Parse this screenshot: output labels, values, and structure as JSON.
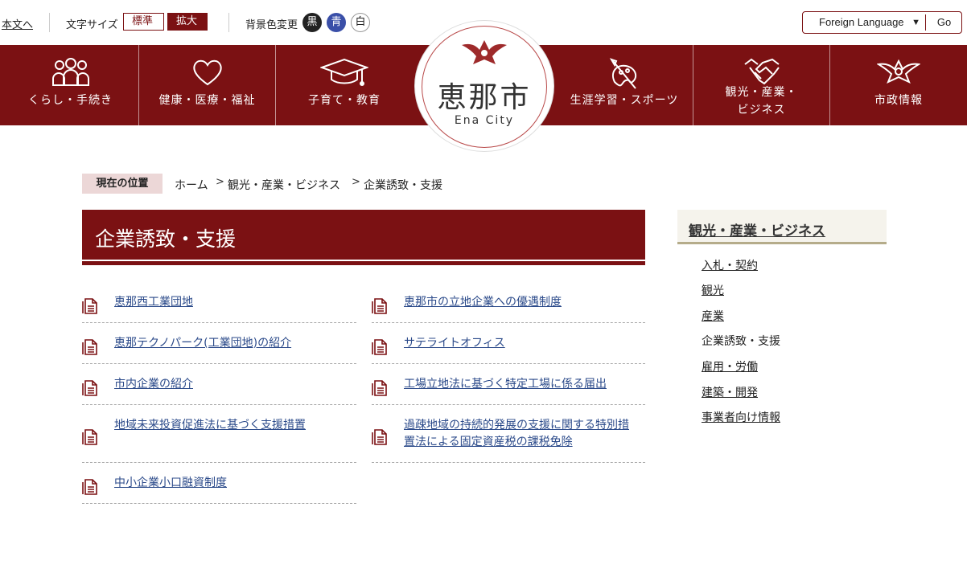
{
  "utility": {
    "skip_link": "本文へ",
    "font_size_label": "文字サイズ",
    "font_standard": "標準",
    "font_large": "拡大",
    "bg_label": "背景色変更",
    "bg_black": "黒",
    "bg_blue": "青",
    "bg_white": "白",
    "language_selected": "Foreign Language",
    "language_go": "Go"
  },
  "nav": {
    "items": [
      {
        "label": "くらし・手続き",
        "icon": "people-icon"
      },
      {
        "label": "健康・医療・福祉",
        "icon": "heart-icon"
      },
      {
        "label": "子育て・教育",
        "icon": "graduation-cap-icon"
      },
      {
        "label": "生涯学習・スポーツ",
        "icon": "palette-icon"
      },
      {
        "label_line1": "観光・産業・",
        "label_line2": "ビジネス",
        "icon": "handshake-icon"
      },
      {
        "label": "市政情報",
        "icon": "city-emblem-icon"
      }
    ],
    "logo_kanji": "恵那市",
    "logo_en": "Ena City"
  },
  "breadcrumb": {
    "here_label": "現在の位置",
    "items": [
      "ホーム",
      "観光・産業・ビジネス",
      "企業誘致・支援"
    ]
  },
  "page_title": "企業誘致・支援",
  "links_left": [
    {
      "line1": "恵那西工業団地"
    },
    {
      "line1": "恵那テクノパーク(工業団地)の紹介"
    },
    {
      "line1": "市内企業の紹介"
    },
    {
      "line1": "地域未来投資促進法に基づく支援措置"
    },
    {
      "line1": "中小企業小口融資制度"
    }
  ],
  "links_right": [
    {
      "line1": "恵那市の立地企業への優遇制度"
    },
    {
      "line1": "サテライトオフィス"
    },
    {
      "line1": "工場立地法に基づく特定工場に係る届出"
    },
    {
      "line1": "過疎地域の持続的発展の支援に関する特別措",
      "line2": "置法による固定資産税の課税免除"
    }
  ],
  "side": {
    "heading": "観光・産業・ビジネス",
    "items": [
      "入札・契約",
      "観光",
      "産業",
      "企業誘致・支援",
      "雇用・労働",
      "建築・開発",
      "事業者向け情報"
    ]
  },
  "colors": {
    "brand": "#7b1113",
    "link": "#2b4a8a",
    "bg_blue_button": "#3a4fa8"
  }
}
